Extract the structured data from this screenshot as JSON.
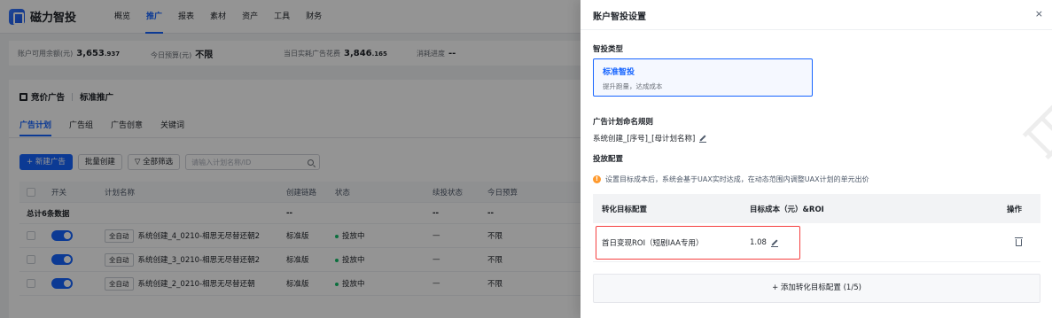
{
  "app": {
    "logo_text": "磁力智投",
    "nav": [
      "概览",
      "推广",
      "报表",
      "素材",
      "资产",
      "工具",
      "财务"
    ],
    "nav_active": "推广"
  },
  "stats": [
    {
      "label": "账户可用余额(元)",
      "value": "3,653",
      "decimal": ".937"
    },
    {
      "label": "今日预算(元)",
      "value": "不限",
      "decimal": ""
    },
    {
      "label": "当日实耗广告花费",
      "value": "3,846",
      "decimal": ".165"
    },
    {
      "label": "消耗进度",
      "value": "--",
      "decimal": ""
    }
  ],
  "breadcrumb": {
    "first": "竞价广告",
    "second": "标准推广"
  },
  "tabs": [
    "广告计划",
    "广告组",
    "广告创意",
    "关键词"
  ],
  "toolbar": {
    "new_label": "+ 新建广告",
    "batch_label": "批量创建",
    "filter_label": "▽ 全部筛选",
    "search_placeholder": "请输入计划名称/ID"
  },
  "table": {
    "headers": [
      "开关",
      "计划名称",
      "创建链路",
      "状态",
      "续投状态",
      "今日预算"
    ],
    "summary": {
      "label": "总计6条数据",
      "link": "--",
      "sp": "--",
      "bud": "--"
    },
    "rows": [
      {
        "tag": "全自动",
        "name": "系统创建_4_0210-相思无尽替还朝2",
        "link": "标准版",
        "status": "投放中",
        "sp": "—",
        "bud": "不限"
      },
      {
        "tag": "全自动",
        "name": "系统创建_3_0210-相思无尽替还朝2",
        "link": "标准版",
        "status": "投放中",
        "sp": "—",
        "bud": "不限"
      },
      {
        "tag": "全自动",
        "name": "系统创建_2_0210-相思无尽替还朝",
        "link": "标准版",
        "status": "投放中",
        "sp": "—",
        "bud": "不限"
      }
    ]
  },
  "drawer": {
    "title": "账户智投设置",
    "close_icon": "×",
    "type_section": "智投类型",
    "type_name": "标准智投",
    "type_desc": "提升跑量，达成成本",
    "naming_section": "广告计划命名规则",
    "naming_value": "系统创建_[序号]_[母计划名称]",
    "delivery_section": "投放配置",
    "notice": "设置目标成本后，系统会基于UAX实时达成，在动态范围内调整UAX计划的单元出价",
    "conv_headers": {
      "target": "转化目标配置",
      "cost": "目标成本（元）&ROI",
      "ops": "操作"
    },
    "conv_rows": [
      {
        "target": "首日变现ROI（短剧IAA专用）",
        "cost": "1.08"
      }
    ],
    "add_label": "+ 添加转化目标配置 (1/5)"
  },
  "watermark_text": "日自网络",
  "colors": {
    "accent": "#1664ff",
    "highlight_box": "#f53f3f",
    "status_green": "#14c06a",
    "warning": "#ff9a2e"
  }
}
